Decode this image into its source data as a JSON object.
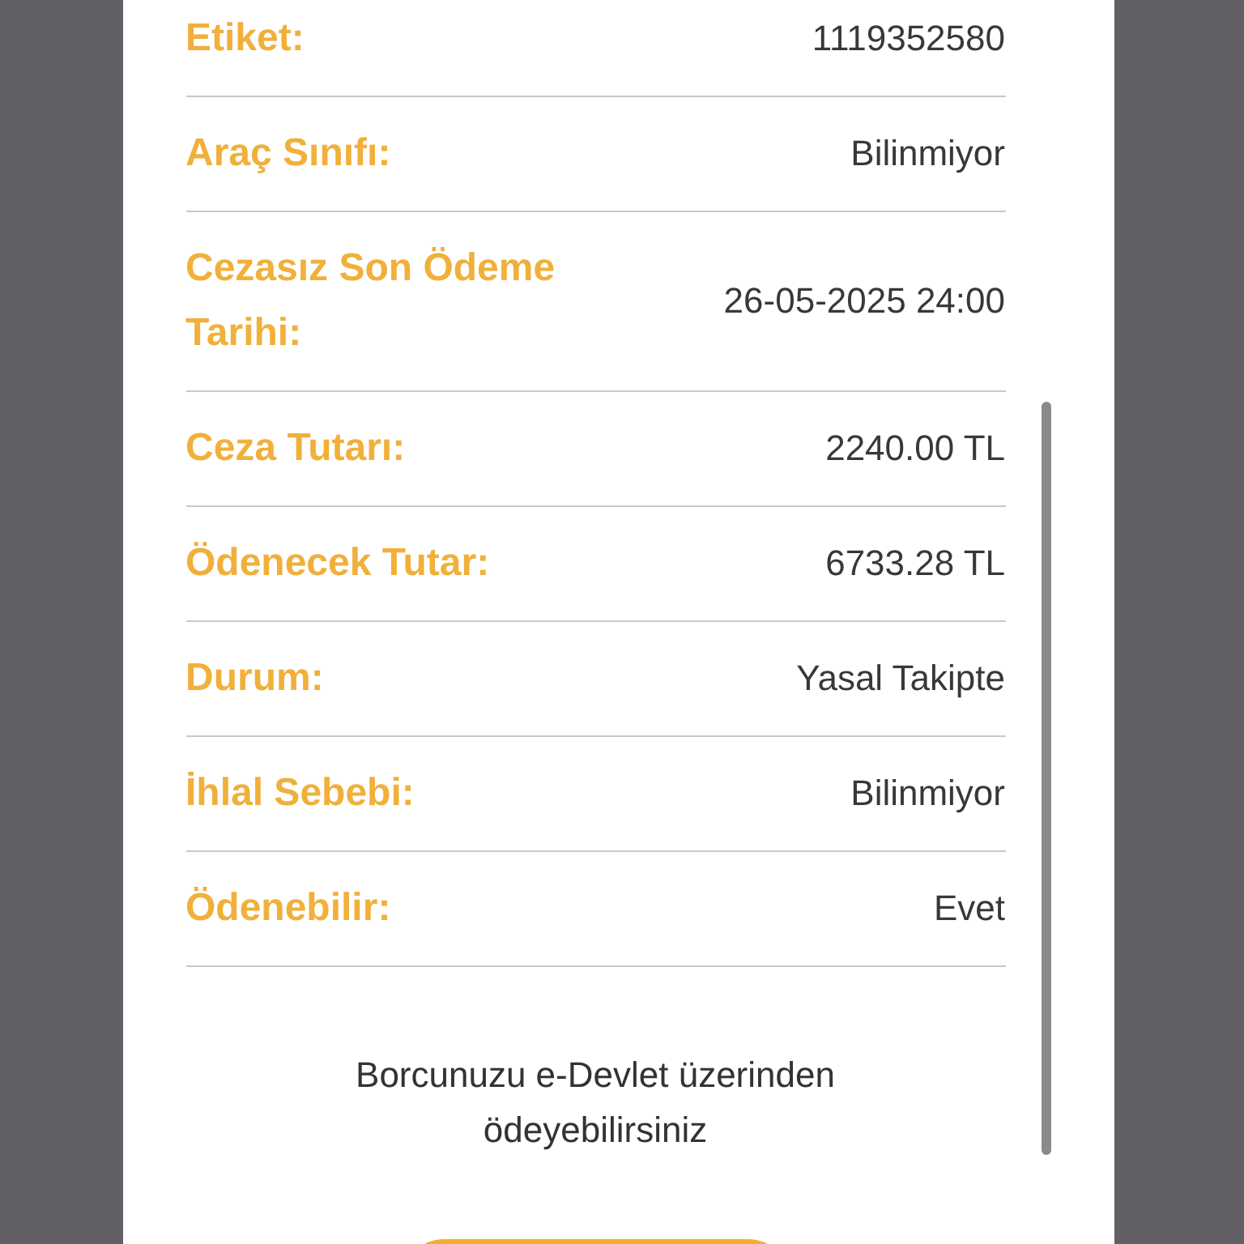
{
  "details": [
    {
      "label": "Etiket:",
      "value": "1119352580"
    },
    {
      "label": "Araç Sınıfı:",
      "value": "Bilinmiyor"
    },
    {
      "label": "Cezasız Son Ödeme Tarihi:",
      "value": "26-05-2025 24:00"
    },
    {
      "label": "Ceza Tutarı:",
      "value": "2240.00 TL"
    },
    {
      "label": "Ödenecek Tutar:",
      "value": "6733.28 TL"
    },
    {
      "label": "Durum:",
      "value": "Yasal Takipte"
    },
    {
      "label": "İhlal Sebebi:",
      "value": "Bilinmiyor"
    },
    {
      "label": "Ödenebilir:",
      "value": "Evet"
    }
  ],
  "note": "Borcunuzu e-Devlet üzerinden ödeyebilirsiniz"
}
